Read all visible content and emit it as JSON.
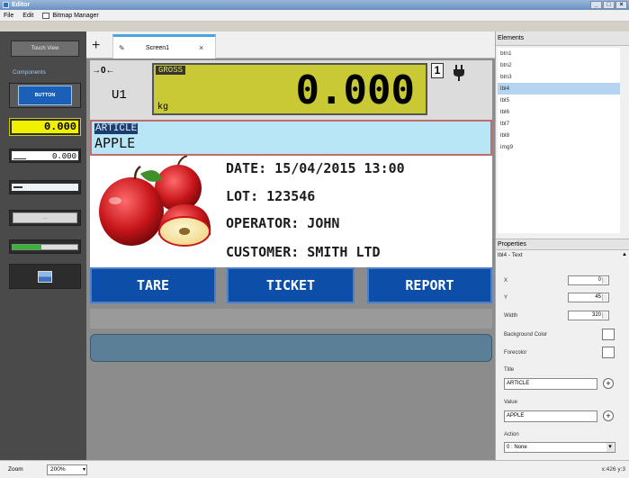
{
  "window": {
    "title": "Editor"
  },
  "menu": {
    "file": "File",
    "edit": "Edit",
    "bitmap": "Bitmap Manager"
  },
  "left": {
    "touch_view": "Touch View",
    "components": "Components",
    "button_thumb": "BUTTON",
    "weight_thumb": "0.000",
    "display_thumb": "0.000",
    "progress_level": 0.45
  },
  "tabs": {
    "add": "+",
    "screen_tab": "Screen1",
    "close": "×"
  },
  "screen": {
    "unit_id": "U1",
    "gross_label": "GROSS",
    "weight": "0.000",
    "unit": "kg",
    "scale_number": "1",
    "article_label": "ARTICLE",
    "article_value": "APPLE",
    "info": {
      "date": "DATE: 15/04/2015 13:00",
      "lot": "LOT: 123546",
      "operator": "OPERATOR: JOHN",
      "customer": "CUSTOMER: SMITH LTD"
    },
    "buttons": {
      "tare": "TARE",
      "ticket": "TICKET",
      "report": "REPORT"
    }
  },
  "elements": {
    "header": "Elements",
    "items": [
      "btn1",
      "btn2",
      "btn3",
      "lbl4",
      "lbl5",
      "lbl6",
      "lbl7",
      "lbl8",
      "img9"
    ],
    "selected_index": 3
  },
  "properties": {
    "header": "Properties",
    "subtitle": "lbl4 - Text",
    "x_label": "X",
    "x_value": "0",
    "y_label": "Y",
    "y_value": "45",
    "width_label": "Width",
    "width_value": "320",
    "bg_label": "Background Color",
    "fg_label": "Forecolor",
    "title_label": "Title",
    "title_value": "ARTICLE",
    "value_label": "Value",
    "value_value": "APPLE",
    "action_label": "Action",
    "action_value": "0 : None"
  },
  "status": {
    "zoom_label": "Zoom",
    "zoom_value": "200%",
    "coords": "x:426 y:3"
  },
  "colors": {
    "accent_blue": "#0d4ea8",
    "display_yellow": "#c9c935",
    "article_bg": "#b8e6f6",
    "progress_green": "#34b534"
  }
}
